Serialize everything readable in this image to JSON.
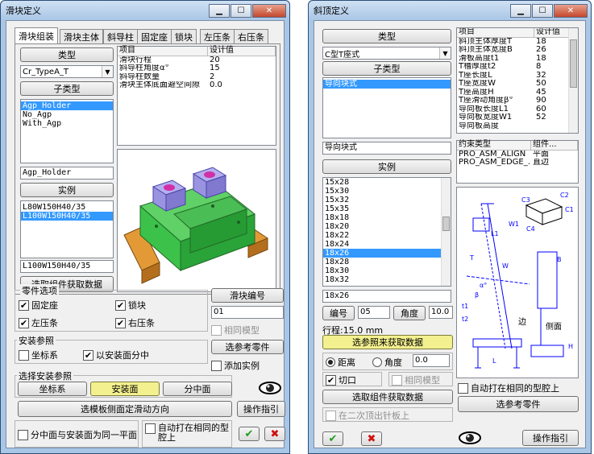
{
  "left": {
    "title": "滑块定义",
    "tabs": [
      "滑块组装",
      "滑块主体",
      "斜导柱",
      "固定座",
      "锁块",
      "左压条",
      "右压条"
    ],
    "type_label": "类型",
    "type_value": "Cr_TypeA_T",
    "subtype_label": "子类型",
    "subtypes": [
      "Agp_Holder",
      "No_Agp",
      "With_Agp"
    ],
    "subtype_selected": "Agp_Holder",
    "instance_label": "实例",
    "instances": [
      "L80W150H40/35",
      "L100W150H40/35"
    ],
    "instance_selected": "L100W150H40/35",
    "pick_button": "选取组件获取数据",
    "table_headers": [
      "项目",
      "设计值"
    ],
    "table_rows": [
      [
        "滑块行程",
        "20"
      ],
      [
        "斜导柱角度α°",
        "15"
      ],
      [
        "斜导柱数量",
        "2"
      ],
      [
        "滑块主体底面避空间隙",
        "0.0"
      ]
    ],
    "parts_group": "零件选项",
    "parts": [
      "固定座",
      "锁块",
      "左压条",
      "右压条"
    ],
    "slider_no_label": "滑块编号",
    "slider_no_value": "01",
    "same_model": "相同模型",
    "install_ref_group": "安装参照",
    "coord_sys": "坐标系",
    "center_on_face": "以安装面分中",
    "select_ref_parts": "选参考零件",
    "add_instance": "添加实例",
    "select_install_ref": "选择安装参照",
    "btn_coord": "坐标系",
    "btn_install_face": "安装面",
    "btn_center_face": "分中面",
    "btn_side_face": "选模板侧面定滑动方向",
    "btn_guide": "操作指引",
    "same_plane": "分中面与安装面为同一平面",
    "auto_cut": "自动打在相同的型腔上",
    "ok": "✔",
    "cancel": "✖"
  },
  "right": {
    "title": "斜顶定义",
    "type_label": "类型",
    "type_value": "C型T座式",
    "subtype_label": "子类型",
    "subtypes": [
      "导向块式"
    ],
    "subtype_selected": "导向块式",
    "subtype_field": "导向块式",
    "instance_label": "实例",
    "instances": [
      "15x28",
      "15x30",
      "15x32",
      "15x35",
      "18x18",
      "18x20",
      "18x22",
      "18x24",
      "18x26",
      "18x28",
      "18x30",
      "18x32"
    ],
    "instance_selected": "18x26",
    "instance_field": "18x26",
    "params_headers": [
      "项目",
      "设计值"
    ],
    "params": [
      [
        "斜顶主体厚度T",
        "18"
      ],
      [
        "斜顶主体宽度B",
        "26"
      ],
      [
        "滑板高度t1",
        "18"
      ],
      [
        "T槽厚度t2",
        "8"
      ],
      [
        "T座长度L",
        "32"
      ],
      [
        "T座宽度W",
        "50"
      ],
      [
        "T座高度H",
        "45"
      ],
      [
        "T座滑动角度β°",
        "90"
      ],
      [
        "导向板长度L1",
        "60"
      ],
      [
        "导向板宽度W1",
        "52"
      ],
      [
        "导向板高度",
        ""
      ]
    ],
    "constraint_headers": [
      "约束类型",
      "组件..."
    ],
    "constraints": [
      [
        "PRO_ASM_ALIGN",
        "平面"
      ],
      [
        "PRO_ASM_EDGE_...",
        "直边"
      ]
    ],
    "number_label": "编号",
    "number_value": "05",
    "angle_label": "角度",
    "angle_value": "10.0",
    "stroke_text": "行程:15.0 mm",
    "select_ref_data": "选参照来获取数据",
    "distance_label": "距离",
    "angle_radio_label": "角度",
    "distance_value": "0.0",
    "cut_label": "切口",
    "same_model": "相同模型",
    "pick_button": "选取组件获取数据",
    "on_ejector_plate": "在二次顶出针板上",
    "auto_cut": "自动打在相同的型腔上",
    "select_ref_parts": "选参考零件",
    "btn_guide": "操作指引",
    "ok": "✔",
    "cancel": "✖",
    "diagram_labels": [
      "C3",
      "C2",
      "C1",
      "C4",
      "W1",
      "L1",
      "W",
      "T",
      "H",
      "B",
      "t1",
      "t2",
      "L",
      "β",
      "α°",
      "边",
      "侧面"
    ]
  },
  "colors": {
    "titlebar": "#a9c6e6",
    "selection": "#3399ff",
    "yellow_button": "#f3f08f",
    "model_green": "#3cc24a",
    "model_purple": "#a9a4e8",
    "model_orange": "#e39a36",
    "diagram_line": "#0000ff"
  }
}
